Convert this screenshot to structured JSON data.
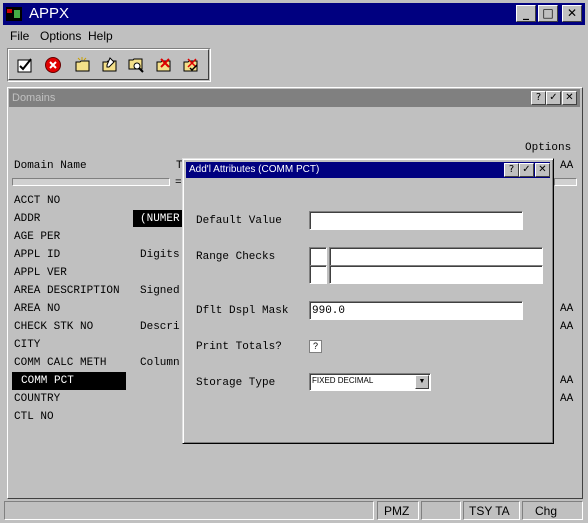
{
  "app": {
    "title": "APPX"
  },
  "menu": {
    "file": "File",
    "options": "Options",
    "help": "Help"
  },
  "toolbar": {
    "icons": [
      "ok-icon",
      "cancel-icon",
      "folder-new-icon",
      "folder-edit-icon",
      "folder-find-icon",
      "folder-delete-icon",
      "folder-check-icon"
    ]
  },
  "domains_window": {
    "title": "Domains",
    "options_label": "Options",
    "header": {
      "domain_name": "Domain Name",
      "t": "T",
      "aa": "AA",
      "eq": "="
    },
    "rows": [
      {
        "name": "ACCT NO",
        "col2": "",
        "aa": ""
      },
      {
        "name": "ADDR",
        "col2": "(NUMER",
        "aa": ""
      },
      {
        "name": "AGE PER",
        "col2": "",
        "aa": ""
      },
      {
        "name": "APPL ID",
        "col2": "Digits",
        "aa": ""
      },
      {
        "name": "APPL VER",
        "col2": "",
        "aa": ""
      },
      {
        "name": "AREA DESCRIPTION",
        "col2": "Signed",
        "aa": ""
      },
      {
        "name": "AREA NO",
        "col2": "",
        "aa": "AA"
      },
      {
        "name": "CHECK STK NO",
        "col2": "Descri",
        "aa": "AA"
      },
      {
        "name": "CITY",
        "col2": "",
        "aa": ""
      },
      {
        "name": "COMM CALC METH",
        "col2": "Column",
        "aa": ""
      },
      {
        "name": "COMM PCT",
        "col2": "",
        "aa": "AA"
      },
      {
        "name": "COUNTRY",
        "col2": "",
        "aa": "AA"
      },
      {
        "name": "CTL NO",
        "col2": "",
        "aa": ""
      }
    ],
    "title_buttons": [
      "?",
      "✓",
      "✕"
    ]
  },
  "dialog": {
    "title": "Add'l Attributes (COMM PCT)",
    "title_buttons": [
      "?",
      "✓",
      "✕"
    ],
    "default_value_label": "Default Value",
    "default_value": "",
    "range_checks_label": "Range Checks",
    "dflt_dspl_mask_label": "Dflt Dspl Mask",
    "dflt_dspl_mask_value": "990.0",
    "print_totals_label": "Print Totals?",
    "print_totals_value": "?",
    "storage_type_label": "Storage Type",
    "storage_type_value": "FIXED DECIMAL"
  },
  "statusbar": {
    "pmz": "PMZ",
    "tsy": "TSY TA",
    "chg": "Chg"
  },
  "colors": {
    "title_bar": "#000080",
    "selection": "#000000",
    "dialog_title": "#000080",
    "inactive_title": "#808080"
  }
}
